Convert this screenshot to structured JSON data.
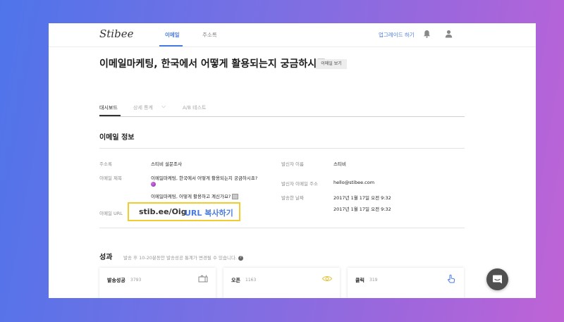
{
  "header": {
    "logo": "Stibee",
    "tabs": [
      {
        "label": "이메일",
        "active": true
      },
      {
        "label": "주소록",
        "active": false
      }
    ],
    "upgrade_label": "업그레이드 하기",
    "icons": [
      "bell-icon",
      "user-icon"
    ]
  },
  "page": {
    "title": "이메일마케팅, 한국에서 어떻게 활용되는지 궁금하시죠?",
    "view_email_label": "이메일 보기"
  },
  "subtabs": [
    {
      "label": "대시보드",
      "active": true
    },
    {
      "label": "상세 통계",
      "active": false
    },
    {
      "label": "A/B 테스트",
      "active": false
    }
  ],
  "email_info": {
    "title": "이메일 정보",
    "address_book_label": "주소록",
    "address_book_value": "스티비 설문조사",
    "subject_label": "이메일 제목",
    "subject_value": "이메일마케팅, 한국에서 어떻게 활용되는지 궁금하시죠?",
    "subject_value_2": "이메일마케팅, 어떻게 활용하고 계신가요?",
    "url_label": "이메일 URL",
    "url_value": "stib.ee/Oig",
    "url_copy_label": "URL 복사하기",
    "sender_name_label": "발신자 이름",
    "sender_name_value": "스티비",
    "sender_email_label": "발신자 이메일 주소",
    "sender_email_value": "hello@stibee.com",
    "sent_date_label": "발송한 날짜",
    "sent_date_value_1": "2017년 1월 17일 오전 9:32",
    "sent_date_value_2": "2017년 1월 17일 오전 9:32"
  },
  "results": {
    "title": "성과",
    "note": "발송 후 10-20분동안 발송성공 통계가 변경될 수 있습니다.",
    "cards": [
      {
        "label": "발송성공",
        "value": "3793",
        "icon": "mailbox-icon"
      },
      {
        "label": "오픈",
        "value": "1163",
        "icon": "eye-icon"
      },
      {
        "label": "클릭",
        "value": "319",
        "icon": "hand-pointer-icon"
      }
    ]
  },
  "colors": {
    "accent": "#4a7be0",
    "highlight": "#f0cc2e",
    "eye_icon": "#e6c23a"
  }
}
